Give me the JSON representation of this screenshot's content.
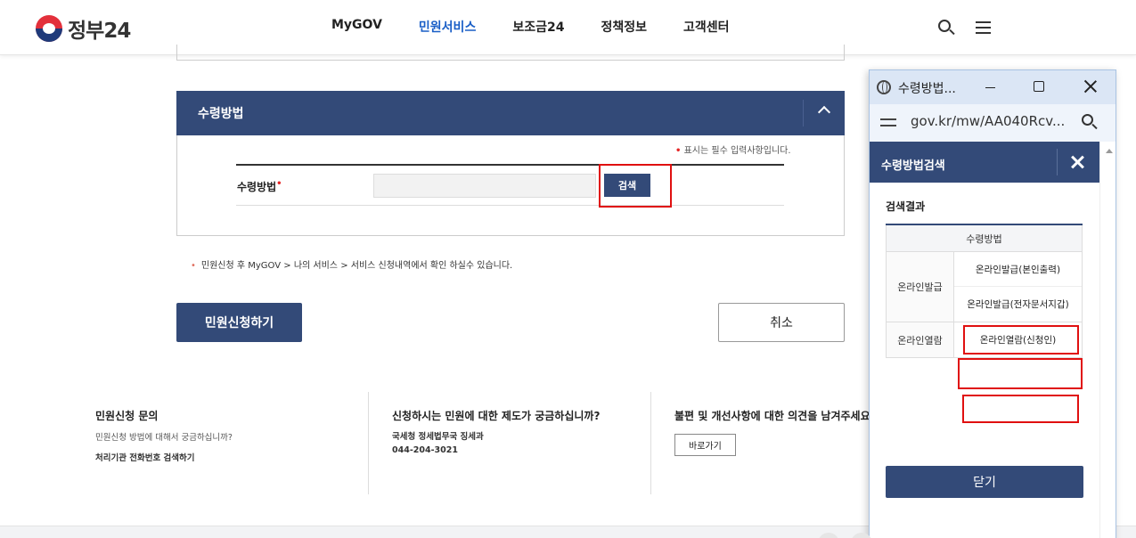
{
  "header": {
    "logo_text": "정부24",
    "nav": [
      "MyGOV",
      "민원서비스",
      "보조금24",
      "정책정보",
      "고객센터"
    ],
    "active_nav_index": 1
  },
  "panel": {
    "title": "수령방법",
    "required_note": "표시는 필수 입력사항입니다.",
    "field_label": "수령방법",
    "search_button": "검색"
  },
  "notice": "민원신청 후 MyGOV > 나의 서비스 > 서비스 신청내역에서 확인 하실수 있습니다.",
  "buttons": {
    "apply": "민원신청하기",
    "cancel": "취소"
  },
  "footer": {
    "col1": {
      "title": "민원신청 문의",
      "desc": "민원신청 방법에 대해서 궁금하십니까?",
      "link": "처리기관 전화번호 검색하기"
    },
    "col2": {
      "title": "신청하시는 민원에 대한 제도가 궁금하십니까?",
      "org": "국세청 정세법무국 징세과",
      "phone": "044-204-3021"
    },
    "col3": {
      "title": "불편 및 개선사항에 대한 의견을 남겨주세요.",
      "button": "바로가기"
    }
  },
  "popup": {
    "window_title": "수령방법...",
    "url": "gov.kr/mw/AA040Rcv...",
    "header_title": "수령방법검색",
    "result_label": "검색결과",
    "table_header": "수령방법",
    "groups": [
      {
        "category": "온라인발급",
        "options": [
          "온라인발급(본인출력)",
          "온라인발급(전자문서지갑)"
        ]
      },
      {
        "category": "온라인열람",
        "options": [
          "온라인열람(신청인)"
        ]
      }
    ],
    "close_button": "닫기"
  },
  "colors": {
    "primary": "#334a78",
    "active_nav": "#1a5fc7",
    "highlight": "#e01010"
  }
}
